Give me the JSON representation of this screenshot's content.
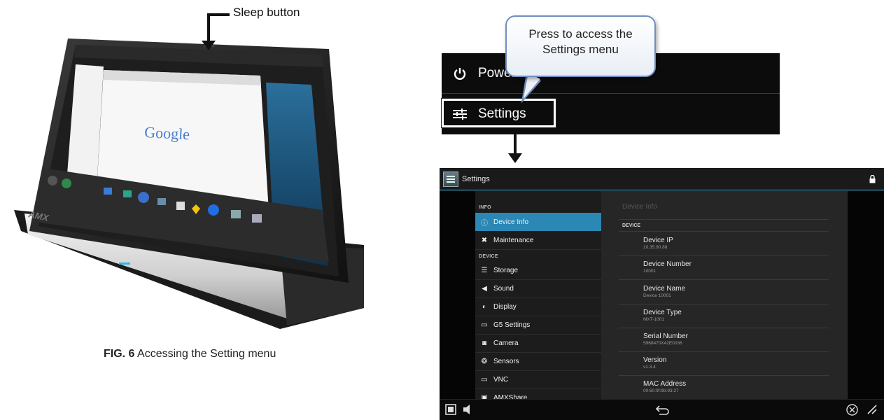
{
  "left_figure": {
    "sleep_label": "Sleep button",
    "device_brand": "AMX",
    "browser_logo": "Google",
    "caption_prefix": "FIG. 6",
    "caption_text": " Accessing the Setting menu"
  },
  "callout": {
    "text": "Press to access the\nSettings menu"
  },
  "menu": {
    "items": [
      {
        "label": "Power",
        "icon": "power-icon"
      },
      {
        "label": "Settings",
        "icon": "sliders-icon"
      }
    ]
  },
  "settings_screen": {
    "title": "Settings",
    "colors": {
      "accent": "#33b5e5",
      "active_item": "#2b87b4"
    },
    "sidebar": {
      "sections": [
        {
          "header": "INFO"
        },
        {
          "header": "DEVICE"
        }
      ],
      "items": [
        {
          "label": "Device Info",
          "icon": "info-icon"
        },
        {
          "label": "Maintenance",
          "icon": "tools-icon"
        },
        {
          "label": "Storage",
          "icon": "storage-icon"
        },
        {
          "label": "Sound",
          "icon": "speaker-icon"
        },
        {
          "label": "Display",
          "icon": "display-icon"
        },
        {
          "label": "G5 Settings",
          "icon": "g5-icon"
        },
        {
          "label": "Camera",
          "icon": "camera-icon"
        },
        {
          "label": "Sensors",
          "icon": "sensor-icon"
        },
        {
          "label": "VNC",
          "icon": "vnc-icon"
        },
        {
          "label": "AMXShare",
          "icon": "share-icon"
        }
      ]
    },
    "detail": {
      "title": "Device Info",
      "section": "DEVICE",
      "items": [
        {
          "label": "Device IP",
          "value": "10.35.90.88"
        },
        {
          "label": "Device Number",
          "value": "10001"
        },
        {
          "label": "Device Name",
          "value": "Device 10001"
        },
        {
          "label": "Device Type",
          "value": "MXT-1001"
        },
        {
          "label": "Serial Number",
          "value": "5968470X42E0036"
        },
        {
          "label": "Version",
          "value": "v1.3.4"
        },
        {
          "label": "MAC Address",
          "value": "00:60:9f:9b:93:27"
        }
      ]
    }
  }
}
